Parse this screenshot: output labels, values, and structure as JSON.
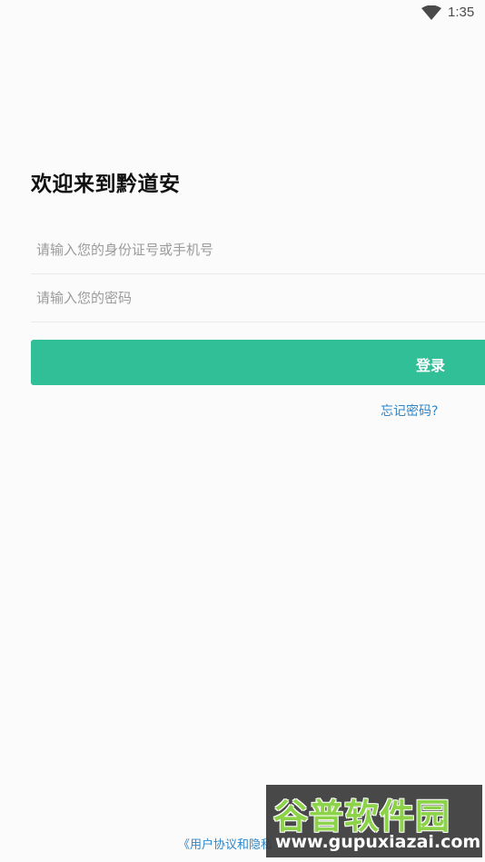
{
  "status_bar": {
    "time": "1:35",
    "wifi_icon": "wifi-icon"
  },
  "login": {
    "title": "欢迎来到黔道安",
    "account_placeholder": "请输入您的身份证号或手机号",
    "password_placeholder": "请输入您的密码",
    "login_button": "登录",
    "forgot_password": "忘记密码?"
  },
  "footer": {
    "agreement_link": "《用户协议和隐私"
  },
  "watermark": {
    "brand": "谷普软件园",
    "url": "www.gupuxiazai.com"
  },
  "colors": {
    "accent": "#30bf96",
    "link": "#2f86c8",
    "background": "#fbfbfb"
  }
}
